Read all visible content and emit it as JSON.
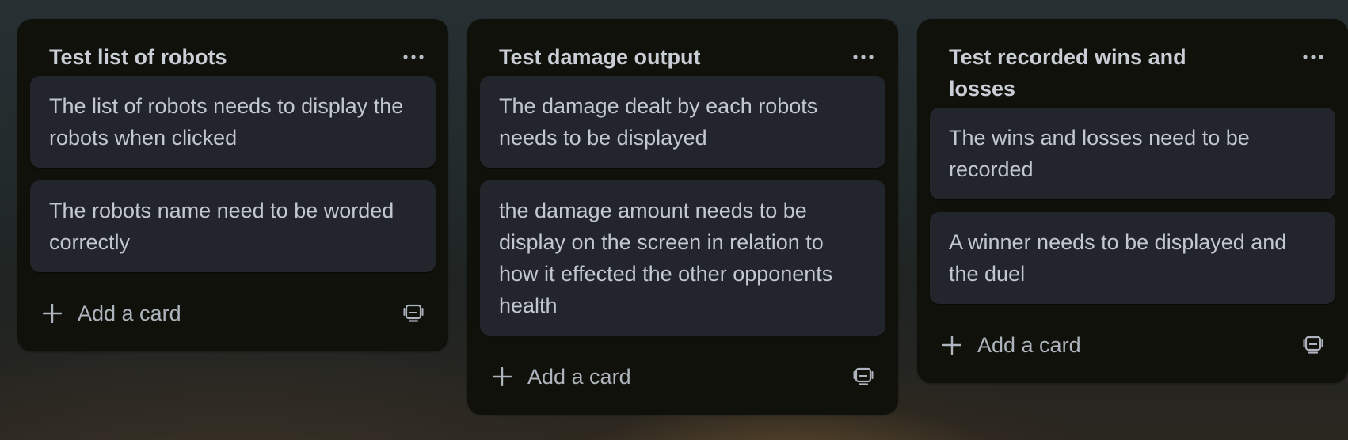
{
  "lists": [
    {
      "title": "Test list of robots",
      "cards": [
        "The list of robots needs to display the robots when clicked",
        "The robots name need to be worded correctly"
      ],
      "add_card_label": "Add a card"
    },
    {
      "title": "Test damage output",
      "cards": [
        "The damage dealt by each robots needs to be displayed",
        "the damage amount needs to be display on the screen in relation to how it effected the other opponents health"
      ],
      "add_card_label": "Add a card"
    },
    {
      "title": "Test recorded wins and losses",
      "cards": [
        "The wins and losses need to be recorded",
        "A winner needs to be displayed and the duel"
      ],
      "add_card_label": "Add a card"
    }
  ],
  "icons": {
    "list_menu": "more-horizontal-icon",
    "add": "plus-icon",
    "template": "card-template-icon"
  },
  "colors": {
    "list_background": "#0f110a",
    "card_background": "#22252b",
    "text": "#c3c8d0"
  }
}
